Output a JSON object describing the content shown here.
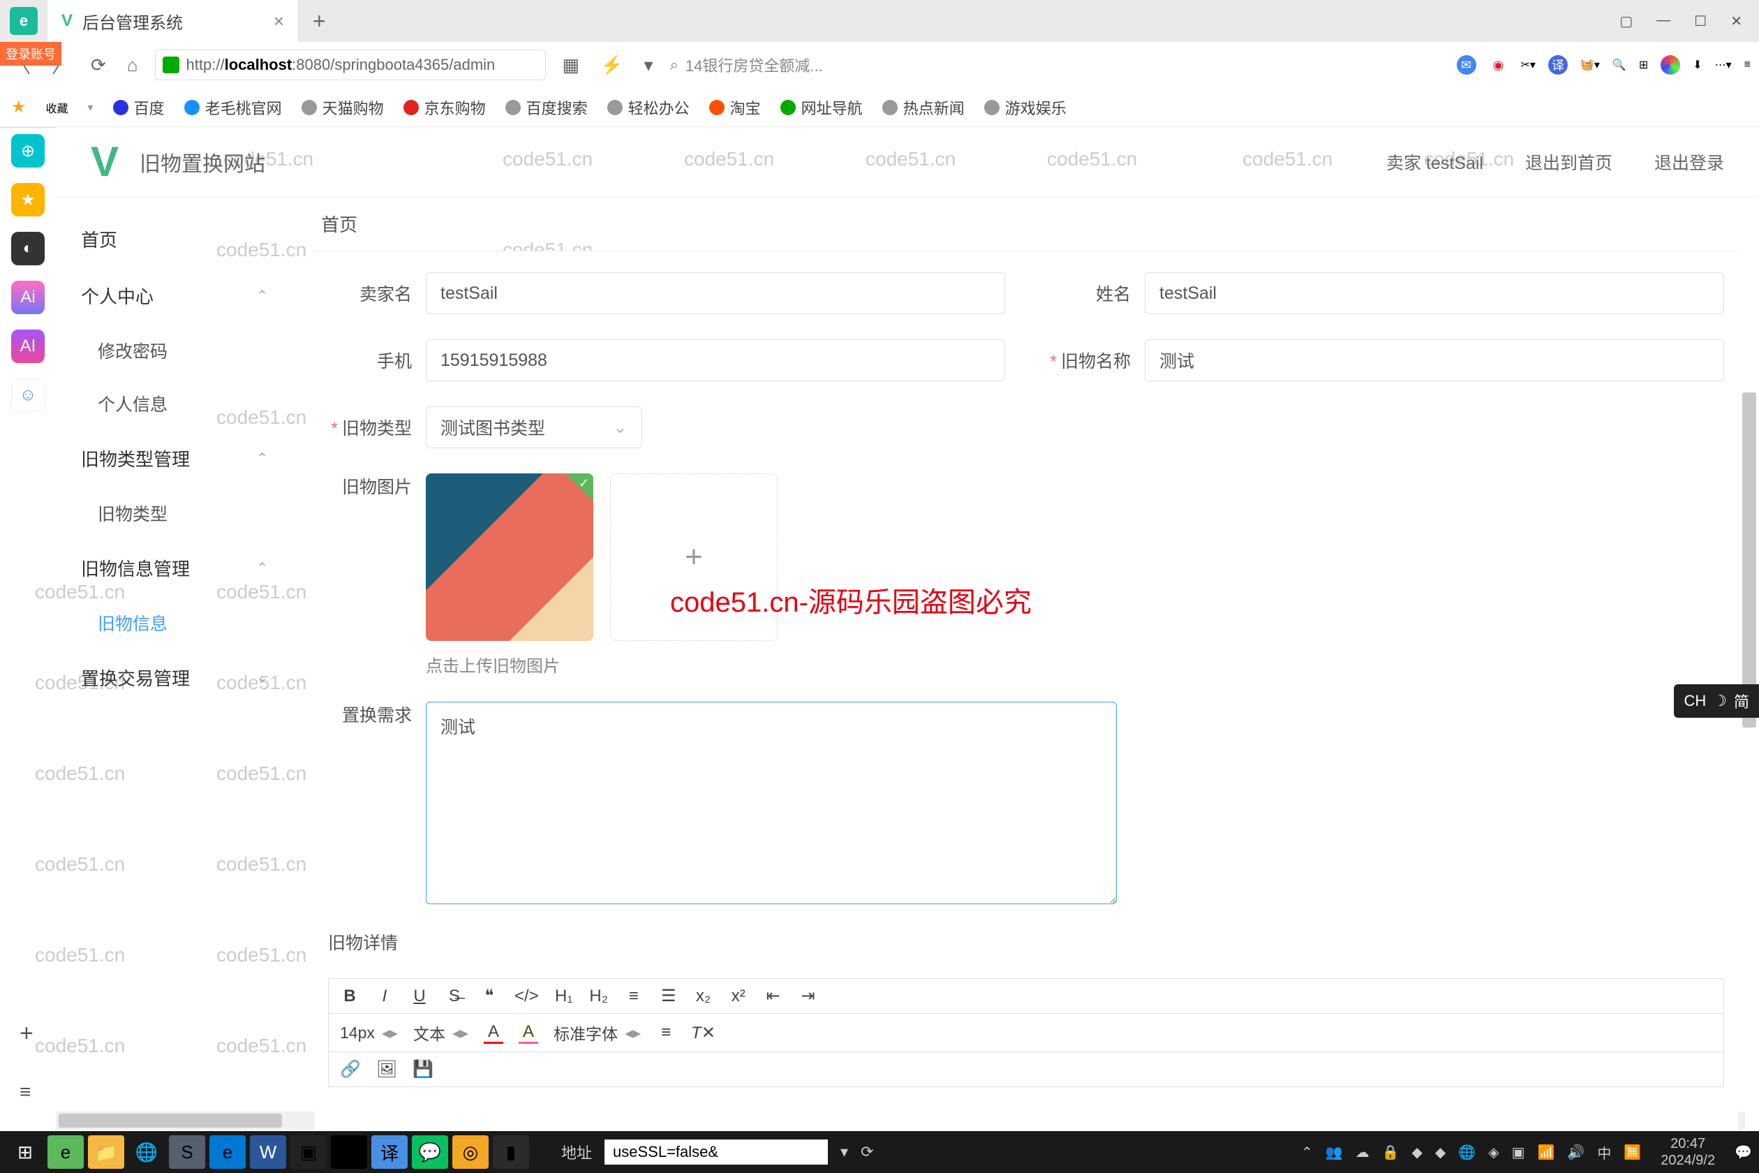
{
  "browser": {
    "tab_title": "后台管理系统",
    "address_prefix": "http://",
    "address_host": "localhost",
    "address_rest": ":8080/springboota4365/admin",
    "search_placeholder": "14银行房贷全额减...",
    "login_badge": "登录账号"
  },
  "bookmarks": {
    "fav": "收藏",
    "items": [
      "百度",
      "老毛桃官网",
      "天猫购物",
      "京东购物",
      "百度搜索",
      "轻松办公",
      "淘宝",
      "网址导航",
      "热点新闻",
      "游戏娱乐"
    ]
  },
  "header": {
    "site_title": "旧物置换网站",
    "user": "卖家 testSail",
    "back_home": "退出到首页",
    "logout": "退出登录"
  },
  "sidebar": {
    "home": "首页",
    "personal": "个人中心",
    "change_pw": "修改密码",
    "personal_info": "个人信息",
    "type_mgmt": "旧物类型管理",
    "type_item": "旧物类型",
    "info_mgmt": "旧物信息管理",
    "info_item": "旧物信息",
    "trade_mgmt": "置换交易管理"
  },
  "breadcrumb": "首页",
  "form": {
    "seller_label": "卖家名",
    "seller_value": "testSail",
    "name_label": "姓名",
    "name_value": "testSail",
    "phone_label": "手机",
    "phone_value": "15915915988",
    "item_name_label": "旧物名称",
    "item_name_value": "测试",
    "item_type_label": "旧物类型",
    "item_type_value": "测试图书类型",
    "pic_label": "旧物图片",
    "pic_hint": "点击上传旧物图片",
    "demand_label": "置换需求",
    "demand_value": "测试",
    "detail_label": "旧物详情"
  },
  "richtext": {
    "fontsize": "14px",
    "text_label": "文本",
    "font_label": "标准字体"
  },
  "overlay": "code51.cn-源码乐园盗图必究",
  "watermark": "code51.cn",
  "ime": {
    "lang": "CH",
    "mode": "简"
  },
  "taskbar": {
    "addr_label": "地址",
    "addr_value": "useSSL=false&",
    "tray_lang": "中",
    "time": "20:47",
    "date": "2024/9/2"
  }
}
